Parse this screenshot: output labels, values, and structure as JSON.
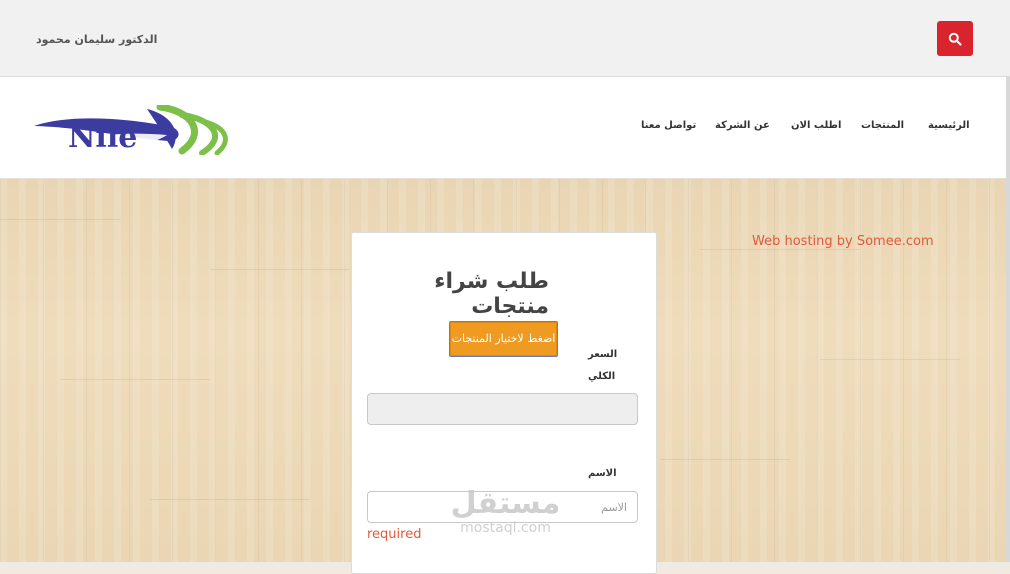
{
  "topbar": {
    "user_name": "الدكتور سليمان محمود",
    "search_button_icon": "search-icon",
    "search_button_color": "#d9232d"
  },
  "navbar": {
    "logo_text": "Nile",
    "items": [
      {
        "label": "الرئيسية"
      },
      {
        "label": "المنتجات"
      },
      {
        "label": "اطلب الان"
      },
      {
        "label": "عن الشركة"
      },
      {
        "label": "تواصل معنا"
      }
    ]
  },
  "sidebar": {
    "hosting_text": "Web hosting by Somee.com"
  },
  "form": {
    "title": "طلب شراء منتجات",
    "choose_button_label": "اضغط لاختيار المنتجات",
    "total_label_line1": "السعر",
    "total_label_line2": "الكلي",
    "total_value": "",
    "name_label": "الاسم",
    "name_placeholder": "الاسم",
    "name_validation": "required"
  },
  "watermark": {
    "arabic": "مستقل",
    "latin": "mostaql.com"
  },
  "colors": {
    "accent_orange": "#ef9a21",
    "error_red": "#e05a3c",
    "logo_blue": "#3c3ca0",
    "logo_green": "#7cc04a"
  }
}
